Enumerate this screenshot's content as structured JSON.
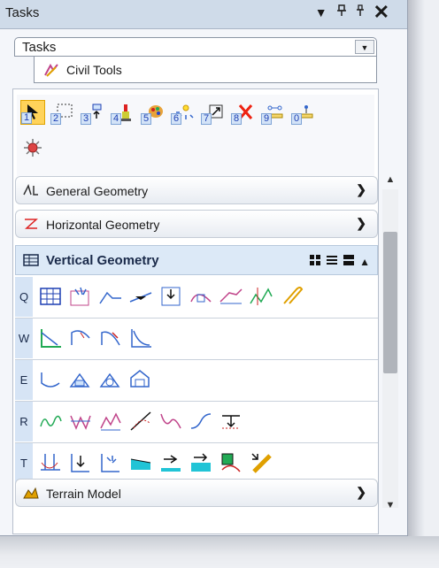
{
  "panel": {
    "title": "Tasks",
    "dropdown_arrow": "▼",
    "pin_icon": "pin-icon",
    "dock_icon": "dock-icon",
    "close": "✕"
  },
  "task_selector": {
    "value": "Tasks",
    "arrow": "▼"
  },
  "active_task": {
    "label": "Civil Tools",
    "icon": "civil-tools-icon"
  },
  "toolbox": {
    "tools": [
      {
        "name": "select-element",
        "num": "1",
        "selected": true
      },
      {
        "name": "selection-fence",
        "num": "2"
      },
      {
        "name": "place-element",
        "num": "3"
      },
      {
        "name": "paint-brush",
        "num": "4"
      },
      {
        "name": "element-palette",
        "num": "5"
      },
      {
        "name": "explode-element",
        "num": "6"
      },
      {
        "name": "scale-element",
        "num": "7"
      },
      {
        "name": "delete-element",
        "num": "8"
      },
      {
        "name": "measure-distance",
        "num": "9"
      },
      {
        "name": "measure-point",
        "num": "0"
      },
      {
        "name": "snap-settings",
        "num": ""
      }
    ]
  },
  "sections": {
    "general": {
      "label": "General Geometry",
      "icon": "general-geometry-icon"
    },
    "horizontal": {
      "label": "Horizontal Geometry",
      "icon": "horizontal-geometry-icon"
    },
    "vertical": {
      "label": "Vertical Geometry",
      "icon": "vertical-geometry-icon"
    },
    "terrain": {
      "label": "Terrain Model",
      "icon": "terrain-model-icon"
    }
  },
  "vertical_rows": [
    {
      "letter": "Q",
      "count": 10
    },
    {
      "letter": "W",
      "count": 4
    },
    {
      "letter": "E",
      "count": 4
    },
    {
      "letter": "R",
      "count": 7
    },
    {
      "letter": "T",
      "count": 9
    }
  ],
  "colors": {
    "accent": "#1d3fb3",
    "header_bg": "#cfdbe9",
    "selected": "#ffd35a",
    "section_active": "#dce9f7"
  }
}
